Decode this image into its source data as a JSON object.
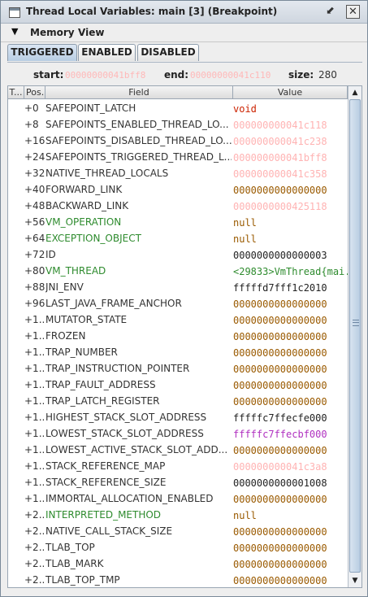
{
  "window": {
    "title": "Thread Local Variables: main [3] (Breakpoint)",
    "minimize_glyph": "⬋",
    "close_glyph": "✕"
  },
  "menubar": {
    "arrow_glyph": "▼",
    "items": [
      "Memory",
      "View"
    ]
  },
  "tabs": [
    {
      "label": "TRIGGERED",
      "selected": true
    },
    {
      "label": "ENABLED",
      "selected": false
    },
    {
      "label": "DISABLED",
      "selected": false
    }
  ],
  "info": {
    "start_label": "start:",
    "start_value": "00000000041bff8",
    "end_label": "end:",
    "end_value": "00000000041c110",
    "size_label": "size:",
    "size_value": "280"
  },
  "table": {
    "headers": [
      "T...",
      "Pos.",
      "Field",
      "Value"
    ],
    "rows": [
      {
        "pos": "+0",
        "field": "SAFEPOINT_LATCH",
        "value": "void",
        "field_color": "#333333",
        "value_color": "#cc2200"
      },
      {
        "pos": "+8",
        "field": "SAFEPOINTS_ENABLED_THREAD_LO...",
        "value": "000000000041c118",
        "field_color": "#333333",
        "value_color": "#ffb3b3"
      },
      {
        "pos": "+16",
        "field": "SAFEPOINTS_DISABLED_THREAD_LO...",
        "value": "000000000041c238",
        "field_color": "#333333",
        "value_color": "#ffb3b3"
      },
      {
        "pos": "+24",
        "field": "SAFEPOINTS_TRIGGERED_THREAD_L...",
        "value": "000000000041bff8",
        "field_color": "#333333",
        "value_color": "#ffb3b3"
      },
      {
        "pos": "+32",
        "field": "NATIVE_THREAD_LOCALS",
        "value": "000000000041c358",
        "field_color": "#333333",
        "value_color": "#ffb3b3"
      },
      {
        "pos": "+40",
        "field": "FORWARD_LINK",
        "value": "0000000000000000",
        "field_color": "#333333",
        "value_color": "#9a5a00"
      },
      {
        "pos": "+48",
        "field": "BACKWARD_LINK",
        "value": "0000000000425118",
        "field_color": "#333333",
        "value_color": "#ffb3b3"
      },
      {
        "pos": "+56",
        "field": "VM_OPERATION",
        "value": "null",
        "field_color": "#2e8b2e",
        "value_color": "#9a5a00"
      },
      {
        "pos": "+64",
        "field": "EXCEPTION_OBJECT",
        "value": "null",
        "field_color": "#2e8b2e",
        "value_color": "#9a5a00"
      },
      {
        "pos": "+72",
        "field": "ID",
        "value": "0000000000000003",
        "field_color": "#333333",
        "value_color": "#222222"
      },
      {
        "pos": "+80",
        "field": "VM_THREAD",
        "value": "<29833>VmThread{mai...",
        "field_color": "#2e8b2e",
        "value_color": "#2e8b2e"
      },
      {
        "pos": "+88",
        "field": "JNI_ENV",
        "value": "fffffd7fff1c2010",
        "field_color": "#333333",
        "value_color": "#222222"
      },
      {
        "pos": "+96",
        "field": "LAST_JAVA_FRAME_ANCHOR",
        "value": "0000000000000000",
        "field_color": "#333333",
        "value_color": "#9a5a00"
      },
      {
        "pos": "+1...",
        "field": "MUTATOR_STATE",
        "value": "0000000000000000",
        "field_color": "#333333",
        "value_color": "#9a5a00"
      },
      {
        "pos": "+1...",
        "field": "FROZEN",
        "value": "0000000000000000",
        "field_color": "#333333",
        "value_color": "#9a5a00"
      },
      {
        "pos": "+1...",
        "field": "TRAP_NUMBER",
        "value": "0000000000000000",
        "field_color": "#333333",
        "value_color": "#9a5a00"
      },
      {
        "pos": "+1...",
        "field": "TRAP_INSTRUCTION_POINTER",
        "value": "0000000000000000",
        "field_color": "#333333",
        "value_color": "#9a5a00"
      },
      {
        "pos": "+1...",
        "field": "TRAP_FAULT_ADDRESS",
        "value": "0000000000000000",
        "field_color": "#333333",
        "value_color": "#9a5a00"
      },
      {
        "pos": "+1...",
        "field": "TRAP_LATCH_REGISTER",
        "value": "0000000000000000",
        "field_color": "#333333",
        "value_color": "#9a5a00"
      },
      {
        "pos": "+1...",
        "field": "HIGHEST_STACK_SLOT_ADDRESS",
        "value": "fffffc7ffecfe000",
        "field_color": "#333333",
        "value_color": "#222222"
      },
      {
        "pos": "+1...",
        "field": "LOWEST_STACK_SLOT_ADDRESS",
        "value": "fffffc7ffecbf000",
        "field_color": "#333333",
        "value_color": "#b030c0"
      },
      {
        "pos": "+1...",
        "field": "LOWEST_ACTIVE_STACK_SLOT_ADD...",
        "value": "0000000000000000",
        "field_color": "#333333",
        "value_color": "#9a5a00"
      },
      {
        "pos": "+1...",
        "field": "STACK_REFERENCE_MAP",
        "value": "000000000041c3a8",
        "field_color": "#333333",
        "value_color": "#ffb3b3"
      },
      {
        "pos": "+1...",
        "field": "STACK_REFERENCE_SIZE",
        "value": "0000000000001008",
        "field_color": "#333333",
        "value_color": "#222222"
      },
      {
        "pos": "+1...",
        "field": "IMMORTAL_ALLOCATION_ENABLED",
        "value": "0000000000000000",
        "field_color": "#333333",
        "value_color": "#9a5a00"
      },
      {
        "pos": "+2...",
        "field": "INTERPRETED_METHOD",
        "value": "null",
        "field_color": "#2e8b2e",
        "value_color": "#9a5a00"
      },
      {
        "pos": "+2...",
        "field": "NATIVE_CALL_STACK_SIZE",
        "value": "0000000000000000",
        "field_color": "#333333",
        "value_color": "#9a5a00"
      },
      {
        "pos": "+2...",
        "field": "TLAB_TOP",
        "value": "0000000000000000",
        "field_color": "#333333",
        "value_color": "#9a5a00"
      },
      {
        "pos": "+2...",
        "field": "TLAB_MARK",
        "value": "0000000000000000",
        "field_color": "#333333",
        "value_color": "#9a5a00"
      },
      {
        "pos": "+2...",
        "field": "TLAB_TOP_TMP",
        "value": "0000000000000000",
        "field_color": "#333333",
        "value_color": "#9a5a00"
      }
    ]
  },
  "scrollbar": {
    "up_glyph": "▲",
    "down_glyph": "▼"
  }
}
